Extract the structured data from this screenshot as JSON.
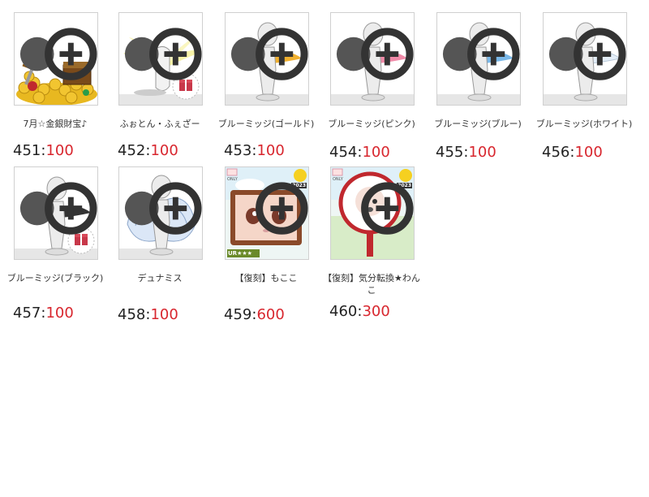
{
  "items": [
    {
      "id": "451",
      "name": "7月☆金銀財宝♪",
      "price": "100",
      "sep": ":",
      "icon": "treasure-icon"
    },
    {
      "id": "452",
      "name": "ふぉとん・ふぇざー",
      "price": "100",
      "sep": ":",
      "icon": "photon-feather-icon"
    },
    {
      "id": "453",
      "name": "ブルーミッジ(ゴールド)",
      "price": "100",
      "sep": ":",
      "icon": "gold-wing-icon"
    },
    {
      "id": "454",
      "name": "ブルーミッジ(ピンク)",
      "price": "100",
      "sep": ":",
      "icon": "pink-wing-icon"
    },
    {
      "id": "455",
      "name": "ブルーミッジ(ブルー)",
      "price": "100",
      "sep": ":",
      "icon": "blue-wing-icon"
    },
    {
      "id": "456",
      "name": "ブルーミッジ(ホワイト)",
      "price": "100",
      "sep": ":",
      "icon": "white-wing-icon"
    },
    {
      "id": "457",
      "name": "ブルーミッジ(ブラック)",
      "price": "100",
      "sep": ":",
      "icon": "black-wing-icon"
    },
    {
      "id": "458",
      "name": "デュナミス",
      "price": "100",
      "sep": ":",
      "icon": "angel-wing-icon"
    },
    {
      "id": "459",
      "name": "【復刻】もここ",
      "price": "600",
      "sep": ":",
      "icon": "mokoko-face-icon"
    },
    {
      "id": "460",
      "name": "【復刻】気分転換★わんこ",
      "price": "300",
      "sep": ":",
      "icon": "mirror-doll-icon"
    }
  ],
  "thumb_labels": {
    "only": "ONLY",
    "year": "2023",
    "rarity": "UR★★★"
  }
}
